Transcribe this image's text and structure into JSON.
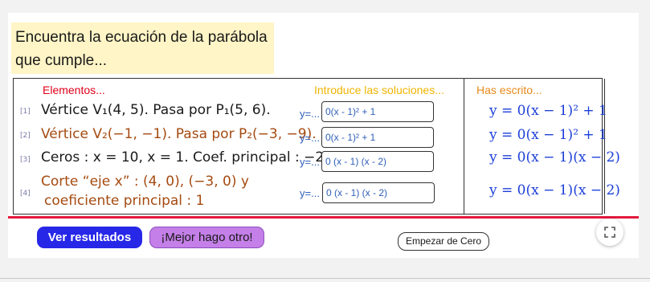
{
  "prompt": {
    "line1": "Encuentra la ecuación de la parábola",
    "line2": "que cumple..."
  },
  "table": {
    "headers": {
      "elements": "Elementos...",
      "solutions": "Introduce las soluciones...",
      "written": "Has escrito..."
    },
    "rows": [
      {
        "index": "[1]",
        "condition": "Vértice V₁(4, 5). Pasa por P₁(5, 6).",
        "condition_color": "#1a1a1a",
        "y_label": "y=...",
        "input_value": "0(x - 1)² + 1",
        "written": "y = 0(x − 1)² + 1"
      },
      {
        "index": "[2]",
        "condition": "Vértice V₂(−1, −1). Pasa por P₂(−3, −9).",
        "condition_color": "#a54a10",
        "y_label": "y=...",
        "input_value": "0(x - 1)² + 1",
        "written": "y = 0(x − 1)² + 1"
      },
      {
        "index": "[3]",
        "condition": "Ceros : x = 10, x = 1. Coef. principal : −2.",
        "condition_color": "#1a1a1a",
        "y_label": "y=...",
        "input_value": "0 (x - 1) (x - 2)",
        "written": "y = 0(x − 1)(x − 2)"
      },
      {
        "index": "[4]",
        "condition_line1": "Corte “eje x” : (4, 0), (−3, 0) y",
        "condition_line2": "coeficiente principal : 1",
        "condition_color": "#a54a10",
        "y_label": "y=...",
        "input_value": "0 (x - 1) (x - 2)",
        "written": "y = 0(x − 1)(x − 2)"
      }
    ]
  },
  "buttons": {
    "results": "Ver resultados",
    "other": "¡Mejor hago otro!",
    "reset": "Empezar de Cero"
  },
  "icons": {
    "fullscreen": "fullscreen-icon"
  },
  "colors": {
    "accent_red": "#e3193d",
    "results_button": "#2727e8",
    "other_button": "#c47fe8",
    "prompt_bg": "#fff5c6"
  }
}
